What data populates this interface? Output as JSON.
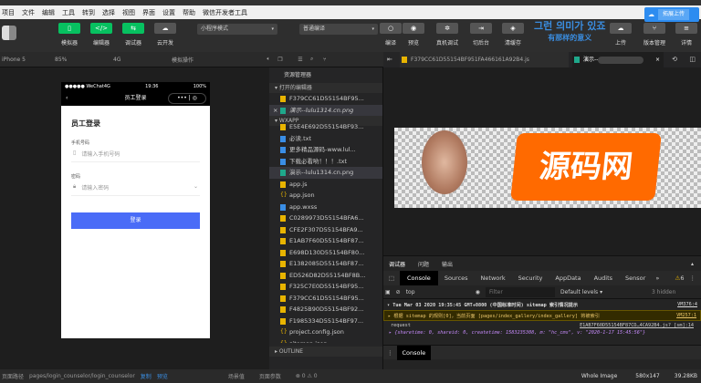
{
  "menu": [
    "项目",
    "文件",
    "编辑",
    "工具",
    "转到",
    "选择",
    "视图",
    "界面",
    "设置",
    "帮助",
    "微信开发者工具"
  ],
  "cloud_label": "拓展上传",
  "toolbar": {
    "simulator": "模拟器",
    "editor": "编辑器",
    "debugger": "调试器",
    "cloud": "云开发",
    "mode": "小程序模式",
    "compile": "普通编译",
    "compile_btn": "编译",
    "preview": "预览",
    "remote": "真机调试",
    "background": "切后台",
    "cache": "清缓存",
    "upload": "上传",
    "version": "版本管理",
    "details": "详情"
  },
  "overlay": {
    "korean": "그런 의미가 있죠",
    "chinese": "有那样的意义"
  },
  "subbar": {
    "device": "iPhone 5",
    "zoom": "85%",
    "network": "4G",
    "operation": "模拟操作"
  },
  "phone": {
    "carrier": "●●●●● WeChat4G",
    "time": "19:36",
    "battery": "100%",
    "nav_title": "员工登录",
    "page_title": "员工登录",
    "phone_label": "手机号码",
    "phone_placeholder": "请输入手机号码",
    "password_label": "密码",
    "password_placeholder": "请输入密码",
    "login": "登录"
  },
  "tree": {
    "title": "资源管理器",
    "open_editors": "打开的编辑器",
    "open_files": [
      "F379CC61D55154BF95...",
      "演示--lulu1314.cn.png"
    ],
    "project": "WXAPP",
    "files": [
      {
        "name": "E5E4E692D55154BF93...",
        "type": "js"
      },
      {
        "name": "必读.txt",
        "type": "txt"
      },
      {
        "name": "更多精品源码-www.lul...",
        "type": "link"
      },
      {
        "name": "下载必看哟！！！.txt",
        "type": "txt"
      },
      {
        "name": "演示--lulu1314.cn.png",
        "type": "png"
      },
      {
        "name": "app.js",
        "type": "js"
      },
      {
        "name": "app.json",
        "type": "json"
      },
      {
        "name": "app.wxss",
        "type": "css"
      },
      {
        "name": "C0289973D55154BFA6...",
        "type": "js"
      },
      {
        "name": "CFE2F307D55154BFA9...",
        "type": "js"
      },
      {
        "name": "E1AB7F60D55154BF87...",
        "type": "js"
      },
      {
        "name": "E698D130D55154BF80...",
        "type": "js"
      },
      {
        "name": "E1382085D55154BF87...",
        "type": "js"
      },
      {
        "name": "ED526D82D55154BF8B...",
        "type": "js"
      },
      {
        "name": "F325C7E0D55154BF95...",
        "type": "js"
      },
      {
        "name": "F379CC61D55154BF95...",
        "type": "js"
      },
      {
        "name": "F4825B90D55154BF92...",
        "type": "js"
      },
      {
        "name": "F1985334D55154BF97...",
        "type": "js"
      },
      {
        "name": "project.config.json",
        "type": "json"
      },
      {
        "name": "sitemap.json",
        "type": "json"
      }
    ],
    "outline": "OUTLINE"
  },
  "tabs": [
    "F379CC61D55154BF951FA466161A92B4.js",
    "演示--"
  ],
  "image_logo": "源码网",
  "debug": {
    "tabs": [
      "调试器",
      "问题",
      "输出"
    ],
    "devtabs": [
      "Console",
      "Sources",
      "Network",
      "Security",
      "AppData",
      "Audits",
      "Sensor",
      "»"
    ],
    "warn_count": "6",
    "context": "top",
    "filter": "Filter",
    "levels": "Default levels ▾",
    "hidden": "3 hidden",
    "log1": "▾ Tue Mar 03 2020 19:35:45 GMT+0800 (中国标准时间) sitemap 索引情况提示",
    "log1_src": "VM376:4",
    "log2": "▸ 根据 sitemap 的规则[0]，当前页面 [pages/index_gallery/index_gallery] 将被索引",
    "log2_src": "VM257:1",
    "log3": "request",
    "log3_src": "E1AB7F60D55154BF87CD…4CA92B4.js? [sm]:14",
    "log4": "▸ {sharetime: 0, shareid: 0, createtime: 1583235308, m: \"hc_cms\", v: \"2020-1-17 15:45:56\"}",
    "drawer": "Console"
  },
  "status": {
    "path_label": "页面路径",
    "path": "pages/login_counselor/login_counselor",
    "copy": "复制",
    "preview": "预览",
    "scene": "场景值",
    "params": "页面参数",
    "errors": "⊗ 0 ⚠ 0",
    "image": "Whole Image",
    "size": "580x147",
    "filesize": "39.28KB"
  }
}
